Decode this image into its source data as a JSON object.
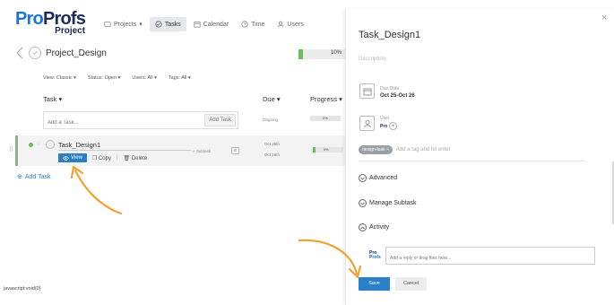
{
  "app": {
    "logo": {
      "part1": "Pro",
      "part2": "Profs",
      "sub": "Project"
    },
    "nav": [
      {
        "label": "Projects",
        "icon": "projects-icon"
      },
      {
        "label": "Tasks",
        "icon": "tasks-icon"
      },
      {
        "label": "Calendar",
        "icon": "calendar-icon"
      },
      {
        "label": "Time",
        "icon": "clock-icon"
      },
      {
        "label": "Users",
        "icon": "user-icon"
      }
    ],
    "nav_projects_caret": "▾"
  },
  "project": {
    "title": "Project_Design",
    "progress_percent": 10,
    "progress_label": "10%"
  },
  "filters": [
    {
      "label": "View:",
      "value": "Classic"
    },
    {
      "label": "Status:",
      "value": "Open"
    },
    {
      "label": "Users:",
      "value": "All"
    },
    {
      "label": "Tags:",
      "value": "All"
    }
  ],
  "columns": {
    "task": "Task ▾",
    "due": "Due ▾",
    "progress": "Progress ▾"
  },
  "add_task": {
    "placeholder": "Add a Task...",
    "button": "Add Task",
    "due_placeholder": "Ongoing",
    "progress_label": "0%"
  },
  "task": {
    "name": "Task_Design1",
    "subtask_label": "+ Subtask",
    "due_line1": "Oct 25th",
    "due_line2": "Oct 26th",
    "progress_label": "0%",
    "actions": {
      "view": "View",
      "copy": "Copy",
      "delete": "Delete"
    }
  },
  "add_task_link": "Add Task",
  "status_text": "javascript:void(0)",
  "panel": {
    "title": "Task_Design1",
    "description_placeholder": "Description",
    "due_date_label": "Due Date",
    "due_date_value": "Oct 25-Oct 26",
    "user_label": "User",
    "tag_chip": "design-task ×",
    "tag_placeholder": "Add a tag and hit enter",
    "sections": {
      "advanced": "Advanced",
      "manage_subtask": "Manage Subtask",
      "activity": "Activity"
    },
    "reply_placeholder": "Add a reply or drag files here...",
    "save": "Save",
    "cancel": "Cancel"
  },
  "colors": {
    "accent": "#2a7fc9",
    "progress": "#6bbf59",
    "arrow": "#f0a22e"
  }
}
